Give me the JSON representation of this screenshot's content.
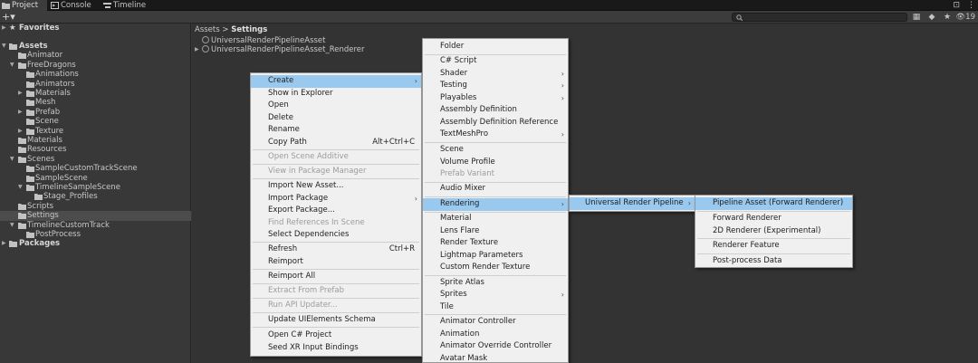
{
  "tabs": [
    {
      "label": "Project",
      "icon": "folder-icon",
      "active": true
    },
    {
      "label": "Console",
      "icon": "console-icon",
      "active": false
    },
    {
      "label": "Timeline",
      "icon": "timeline-icon",
      "active": false
    }
  ],
  "toolbar": {
    "create_label": "+▾",
    "hidden_count": "19"
  },
  "tree": {
    "favorites": "Favorites",
    "assets": "Assets",
    "items": [
      {
        "label": "Animator"
      },
      {
        "label": "FreeDragons"
      },
      {
        "label": "Animations"
      },
      {
        "label": "Animators"
      },
      {
        "label": "Materials"
      },
      {
        "label": "Mesh"
      },
      {
        "label": "Prefab"
      },
      {
        "label": "Scene"
      },
      {
        "label": "Texture"
      },
      {
        "label": "Materials"
      },
      {
        "label": "Resources"
      },
      {
        "label": "Scenes"
      },
      {
        "label": "SampleCustomTrackScene"
      },
      {
        "label": "SampleScene"
      },
      {
        "label": "TimelineSampleScene"
      },
      {
        "label": "Stage_Profiles"
      },
      {
        "label": "Scripts"
      },
      {
        "label": "Settings"
      },
      {
        "label": "TimelineCustomTrack"
      },
      {
        "label": "PostProcess"
      }
    ],
    "packages": "Packages"
  },
  "content": {
    "breadcrumb_root": "Assets",
    "breadcrumb_sep": " > ",
    "breadcrumb_current": "Settings",
    "assets": [
      "UniversalRenderPipelineAsset",
      "UniversalRenderPipelineAsset_Renderer"
    ]
  },
  "menu1": {
    "items": [
      {
        "label": "Create"
      },
      {
        "label": "Show in Explorer"
      },
      {
        "label": "Open"
      },
      {
        "label": "Delete"
      },
      {
        "label": "Rename"
      },
      {
        "label": "Copy Path",
        "shortcut": "Alt+Ctrl+C"
      },
      {
        "label": "Open Scene Additive"
      },
      {
        "label": "View in Package Manager"
      },
      {
        "label": "Import New Asset..."
      },
      {
        "label": "Import Package"
      },
      {
        "label": "Export Package..."
      },
      {
        "label": "Find References In Scene"
      },
      {
        "label": "Select Dependencies"
      },
      {
        "label": "Refresh",
        "shortcut": "Ctrl+R"
      },
      {
        "label": "Reimport"
      },
      {
        "label": "Reimport All"
      },
      {
        "label": "Extract From Prefab"
      },
      {
        "label": "Run API Updater..."
      },
      {
        "label": "Update UIElements Schema"
      },
      {
        "label": "Open C# Project"
      },
      {
        "label": "Seed XR Input Bindings"
      }
    ]
  },
  "menu2": {
    "items": [
      {
        "label": "Folder"
      },
      {
        "label": "C# Script"
      },
      {
        "label": "Shader"
      },
      {
        "label": "Testing"
      },
      {
        "label": "Playables"
      },
      {
        "label": "Assembly Definition"
      },
      {
        "label": "Assembly Definition Reference"
      },
      {
        "label": "TextMeshPro"
      },
      {
        "label": "Scene"
      },
      {
        "label": "Volume Profile"
      },
      {
        "label": "Prefab Variant"
      },
      {
        "label": "Audio Mixer"
      },
      {
        "label": "Rendering"
      },
      {
        "label": "Material"
      },
      {
        "label": "Lens Flare"
      },
      {
        "label": "Render Texture"
      },
      {
        "label": "Lightmap Parameters"
      },
      {
        "label": "Custom Render Texture"
      },
      {
        "label": "Sprite Atlas"
      },
      {
        "label": "Sprites"
      },
      {
        "label": "Tile"
      },
      {
        "label": "Animator Controller"
      },
      {
        "label": "Animation"
      },
      {
        "label": "Animator Override Controller"
      },
      {
        "label": "Avatar Mask"
      }
    ]
  },
  "menu3": {
    "items": [
      {
        "label": "Universal Render Pipeline"
      }
    ]
  },
  "menu4": {
    "items": [
      {
        "label": "Pipeline Asset (Forward Renderer)"
      },
      {
        "label": "Forward Renderer"
      },
      {
        "label": "2D Renderer (Experimental)"
      },
      {
        "label": "Renderer Feature"
      },
      {
        "label": "Post-process Data"
      }
    ]
  },
  "colors": {
    "highlight": "#99c9ef",
    "menu_bg": "#f0f0f0",
    "panel_bg": "#383838"
  }
}
